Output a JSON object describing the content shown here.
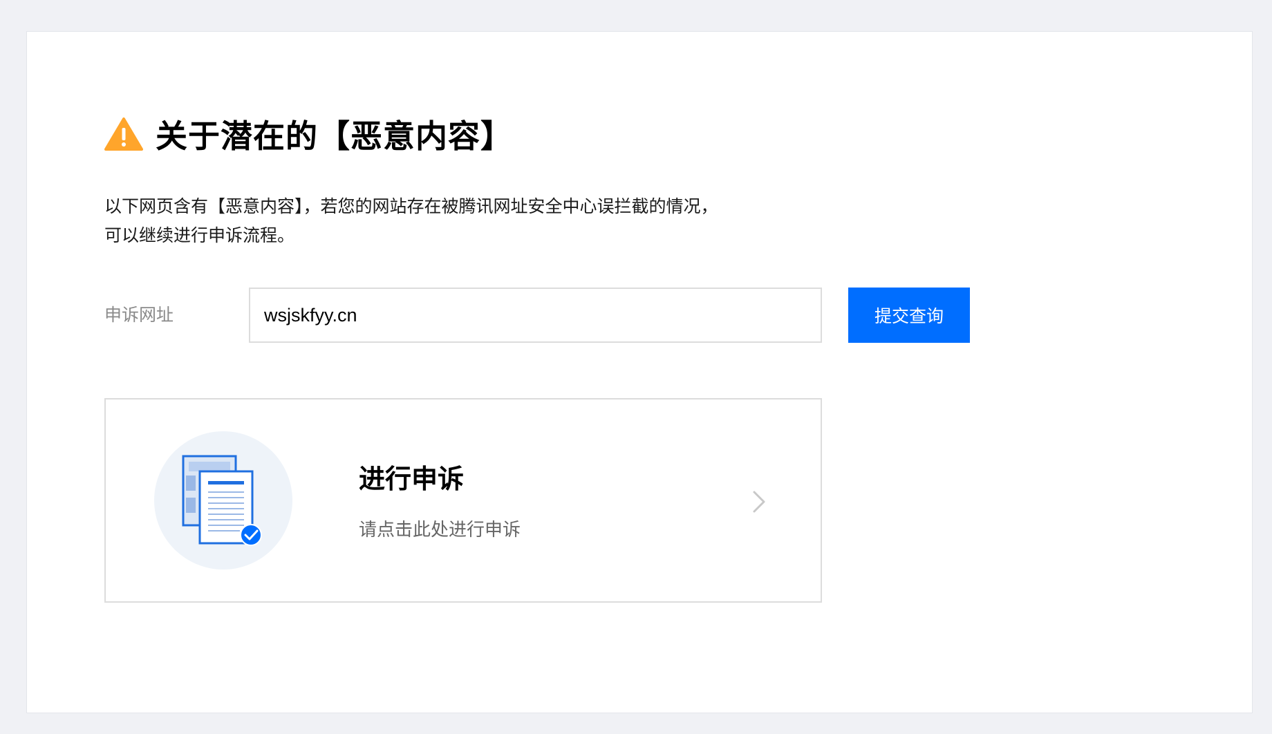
{
  "page": {
    "title": "关于潜在的【恶意内容】",
    "description_line1": "以下网页含有【恶意内容】，若您的网站存在被腾讯网址安全中心误拦截的情况，",
    "description_line2": "可以继续进行申诉流程。"
  },
  "form": {
    "label": "申诉网址",
    "url_value": "wsjskfyy.cn",
    "submit_label": "提交查询"
  },
  "appeal_card": {
    "title": "进行申诉",
    "subtitle": "请点击此处进行申诉",
    "icon": "document-check-icon",
    "chevron_icon": "chevron-right-icon"
  },
  "colors": {
    "accent": "#006eff",
    "warning": "#ffa52b",
    "background": "#f0f1f5"
  }
}
